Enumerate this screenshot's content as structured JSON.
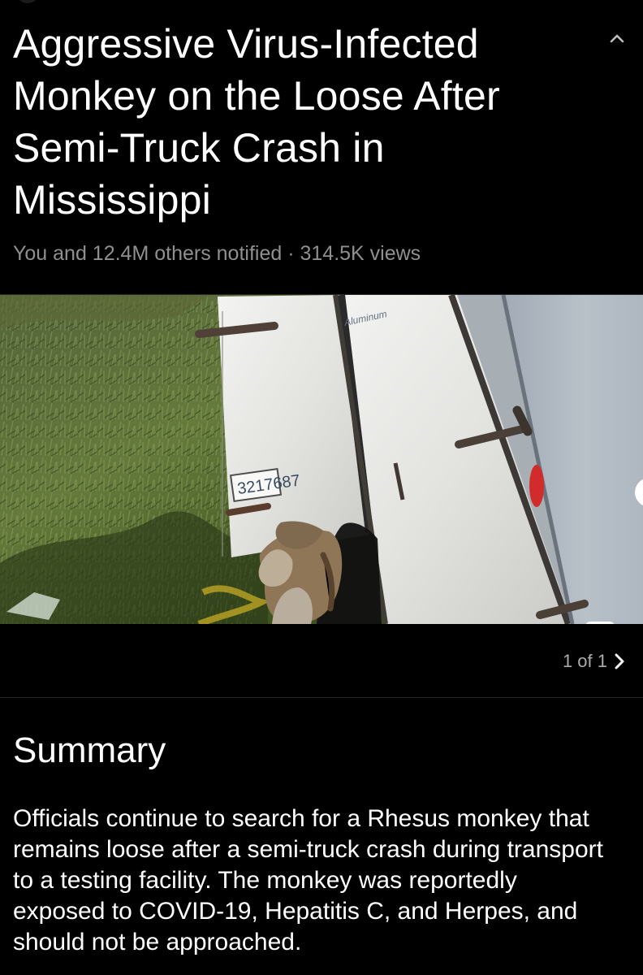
{
  "article": {
    "title": "Aggressive Virus-Infected Monkey on the Loose After Semi-Truck Crash in Mississippi",
    "meta": "You and 12.4M others notified · 314.5K views",
    "collapse_icon": "chevron-up-icon"
  },
  "media": {
    "image_icon": "image-icon",
    "trailer_number": "3217687",
    "trailer_brand": "Aluminum",
    "pager": "1 of 1",
    "next_icon": "chevron-right-icon"
  },
  "summary": {
    "heading": "Summary",
    "text": "Officials continue to search for a Rhesus monkey that remains loose after a semi-truck crash during transport to a testing facility. The monkey was reportedly exposed to COVID-19, Hepatitis C, and Herpes, and should not be approached."
  },
  "colors": {
    "background": "#000000",
    "text": "#ffffff",
    "muted_text": "#8f8f8f",
    "divider": "#272727"
  }
}
